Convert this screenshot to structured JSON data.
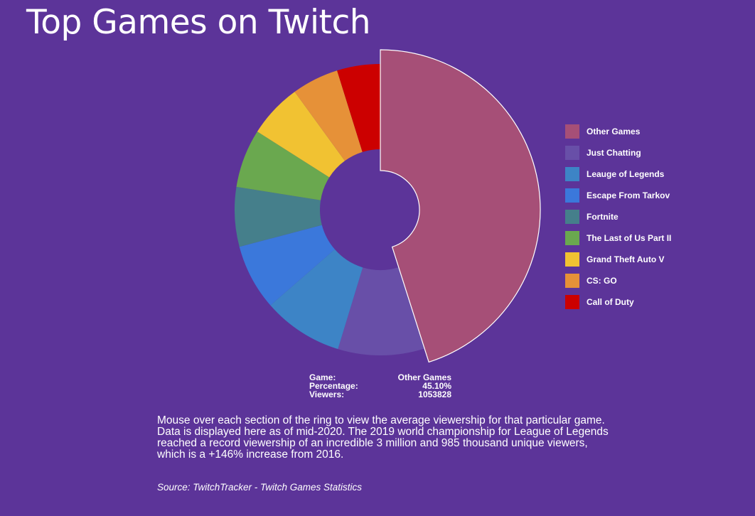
{
  "title": "Top Games on Twitch",
  "chart_data": {
    "type": "pie",
    "variant": "donut",
    "highlighted": "Other Games",
    "legend_position": "right",
    "categories": [
      "Other Games",
      "Just Chatting",
      "Leauge of Legends",
      "Escape From Tarkov",
      "Fortnite",
      "The Last of Us Part II",
      "Grand Theft Auto V",
      "CS: GO",
      "Call of Duty"
    ],
    "values": [
      45.1,
      9.6,
      8.9,
      7.3,
      6.6,
      6.5,
      6.0,
      5.2,
      4.8
    ],
    "unit": "%",
    "colors": [
      "#a64f77",
      "#684fa8",
      "#3d84c6",
      "#3b78db",
      "#457f8b",
      "#6aa84f",
      "#f1c232",
      "#e69138",
      "#cc0000"
    ]
  },
  "tooltip": {
    "game_label": "Game:",
    "game_value": "Other Games",
    "percentage_label": "Percentage:",
    "percentage_value": "45.10%",
    "viewers_label": "Viewers:",
    "viewers_value": "1053828"
  },
  "description": "Mouse over each section of the ring to view the average viewership for that particular game. Data is displayed here as of mid-2020. The 2019 world championship for League of Legends reached a record viewership of an incredible 3 million and 985 thousand unique viewers, which is a +146% increase from 2016.",
  "source": "Source: TwitchTracker - Twitch Games Statistics"
}
